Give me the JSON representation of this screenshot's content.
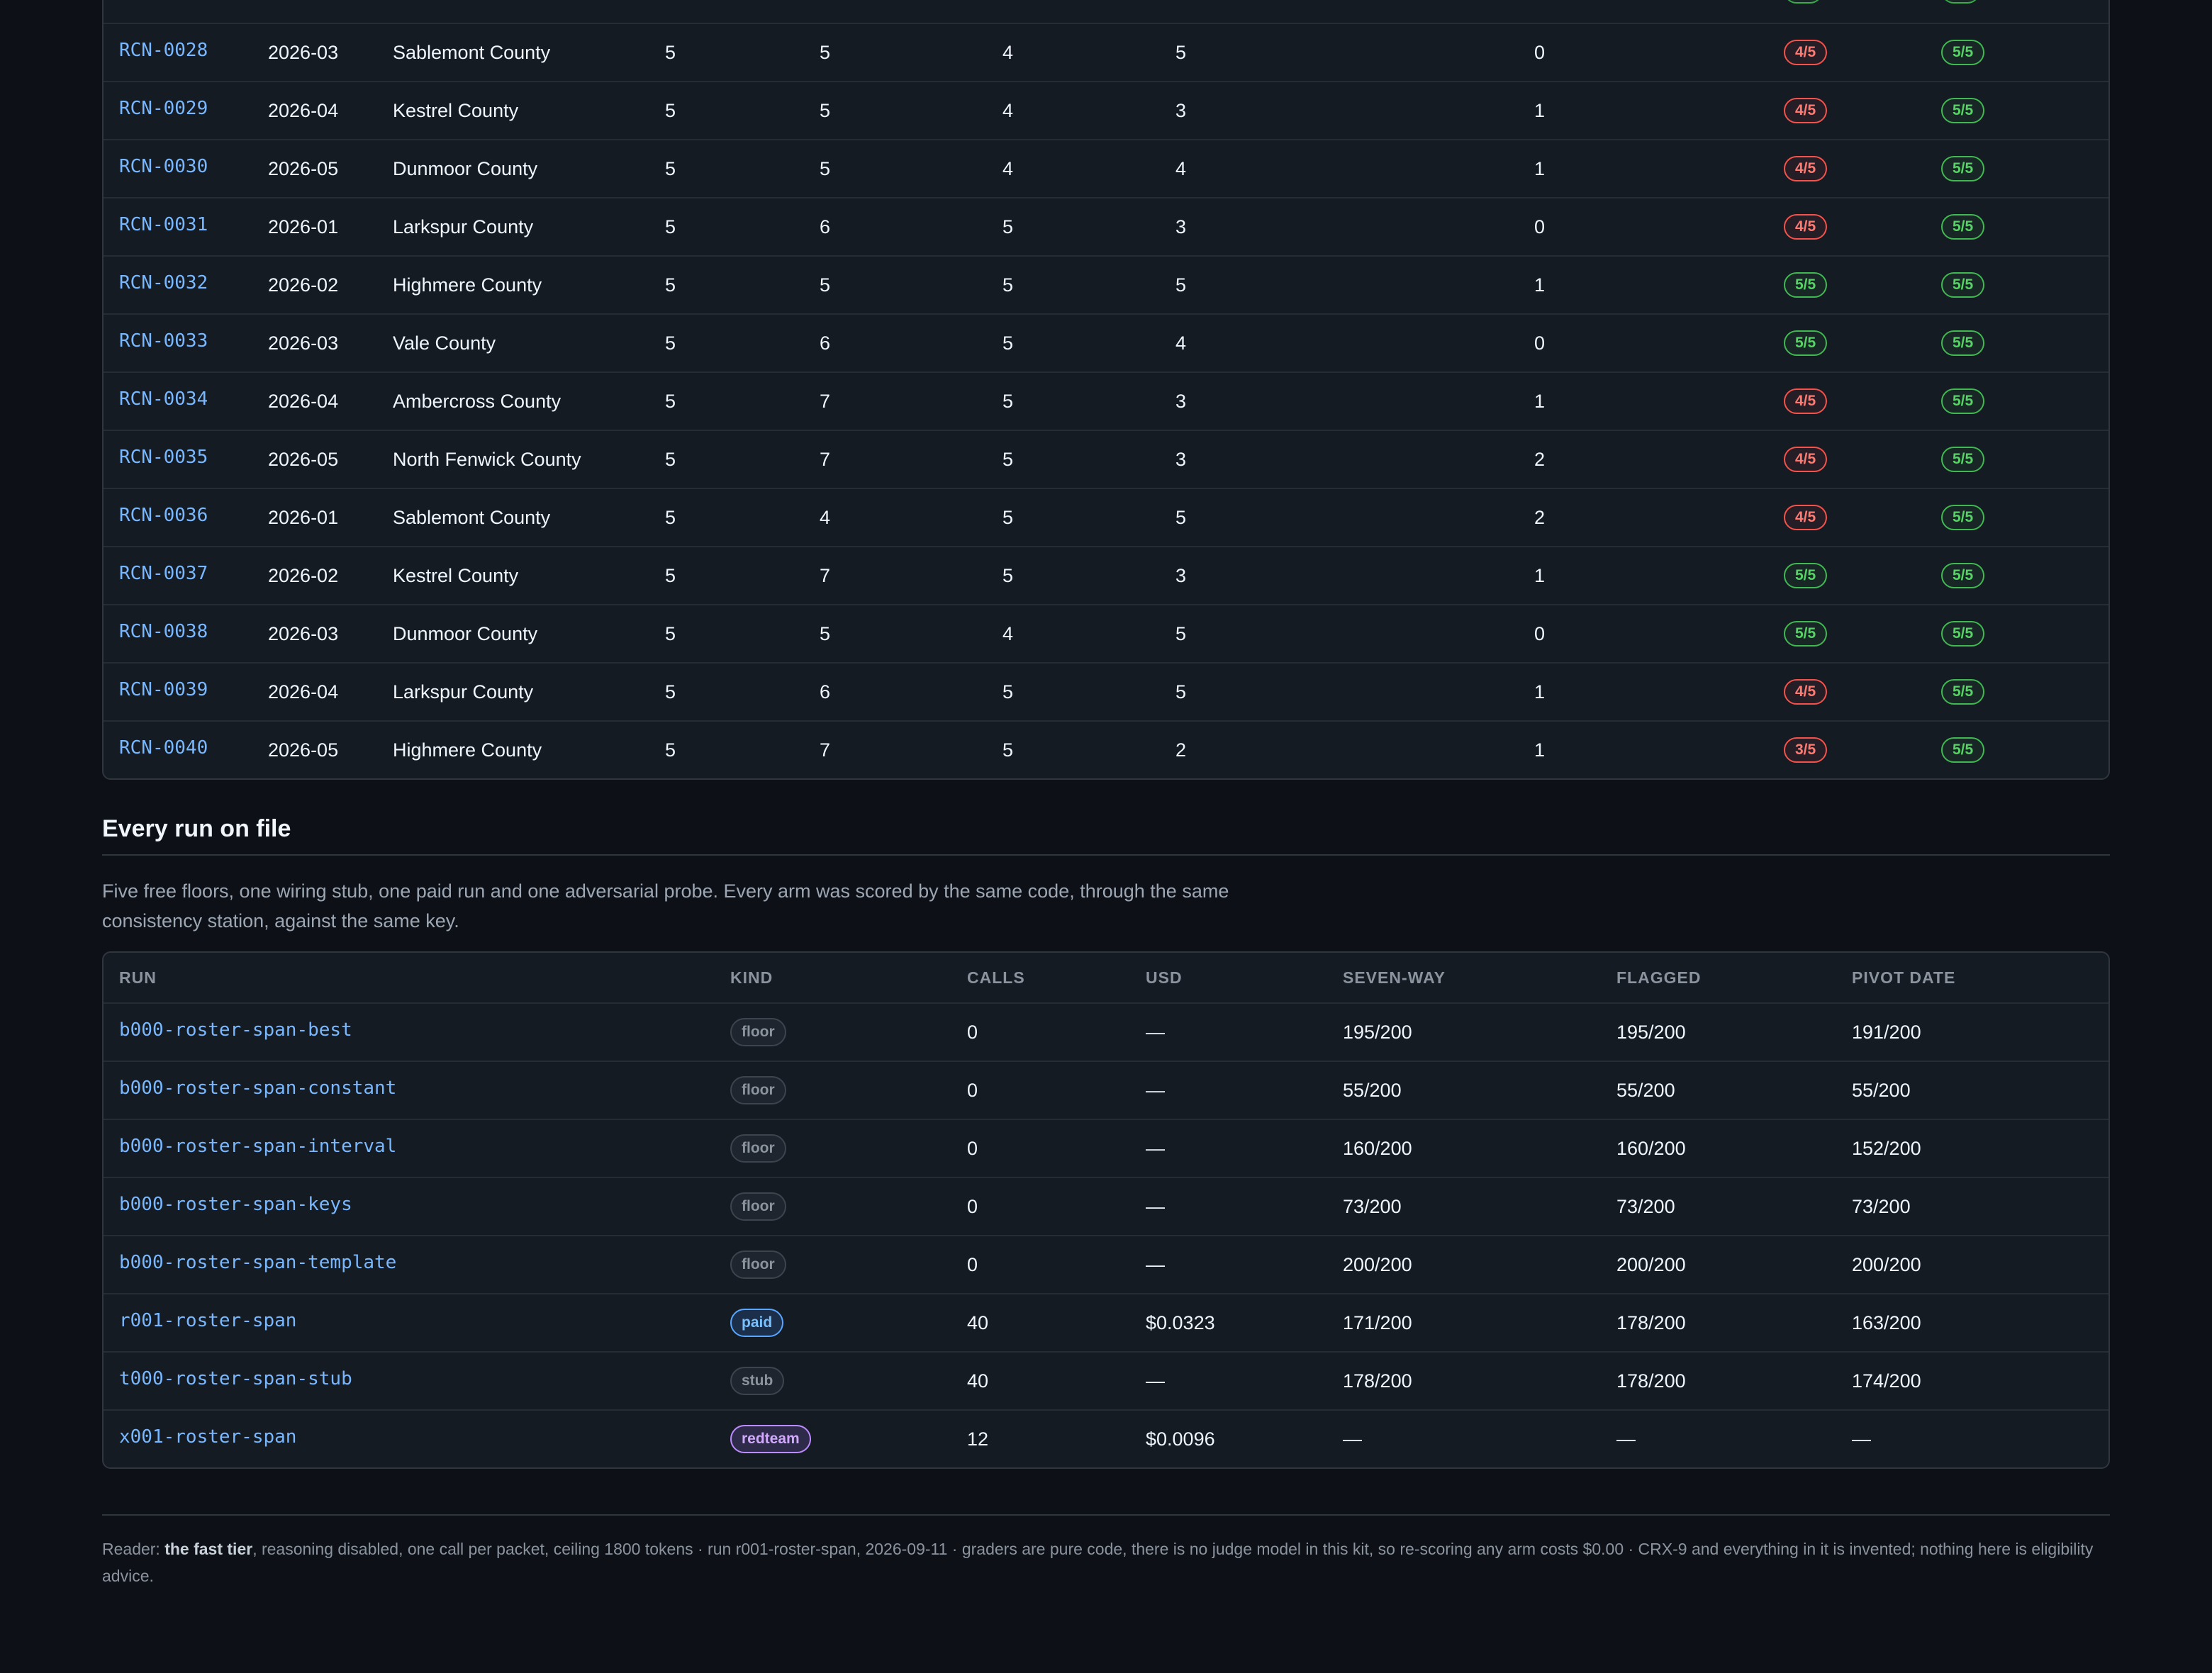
{
  "recon_table": {
    "rows": [
      {
        "id": "RCN-0028",
        "month": "2026-03",
        "county": "Sablemont County",
        "c1": "5",
        "c2": "5",
        "c3": "4",
        "c4": "5",
        "c5": "0",
        "s1": "4/5",
        "s1_status": "bad",
        "s2": "5/5",
        "s2_status": "good"
      },
      {
        "id": "RCN-0029",
        "month": "2026-04",
        "county": "Kestrel County",
        "c1": "5",
        "c2": "5",
        "c3": "4",
        "c4": "3",
        "c5": "1",
        "s1": "4/5",
        "s1_status": "bad",
        "s2": "5/5",
        "s2_status": "good"
      },
      {
        "id": "RCN-0030",
        "month": "2026-05",
        "county": "Dunmoor County",
        "c1": "5",
        "c2": "5",
        "c3": "4",
        "c4": "4",
        "c5": "1",
        "s1": "4/5",
        "s1_status": "bad",
        "s2": "5/5",
        "s2_status": "good"
      },
      {
        "id": "RCN-0031",
        "month": "2026-01",
        "county": "Larkspur County",
        "c1": "5",
        "c2": "6",
        "c3": "5",
        "c4": "3",
        "c5": "0",
        "s1": "4/5",
        "s1_status": "bad",
        "s2": "5/5",
        "s2_status": "good"
      },
      {
        "id": "RCN-0032",
        "month": "2026-02",
        "county": "Highmere County",
        "c1": "5",
        "c2": "5",
        "c3": "5",
        "c4": "5",
        "c5": "1",
        "s1": "5/5",
        "s1_status": "good",
        "s2": "5/5",
        "s2_status": "good"
      },
      {
        "id": "RCN-0033",
        "month": "2026-03",
        "county": "Vale County",
        "c1": "5",
        "c2": "6",
        "c3": "5",
        "c4": "4",
        "c5": "0",
        "s1": "5/5",
        "s1_status": "good",
        "s2": "5/5",
        "s2_status": "good"
      },
      {
        "id": "RCN-0034",
        "month": "2026-04",
        "county": "Ambercross County",
        "c1": "5",
        "c2": "7",
        "c3": "5",
        "c4": "3",
        "c5": "1",
        "s1": "4/5",
        "s1_status": "bad",
        "s2": "5/5",
        "s2_status": "good"
      },
      {
        "id": "RCN-0035",
        "month": "2026-05",
        "county": "North Fenwick County",
        "c1": "5",
        "c2": "7",
        "c3": "5",
        "c4": "3",
        "c5": "2",
        "s1": "4/5",
        "s1_status": "bad",
        "s2": "5/5",
        "s2_status": "good"
      },
      {
        "id": "RCN-0036",
        "month": "2026-01",
        "county": "Sablemont County",
        "c1": "5",
        "c2": "4",
        "c3": "5",
        "c4": "5",
        "c5": "2",
        "s1": "4/5",
        "s1_status": "bad",
        "s2": "5/5",
        "s2_status": "good"
      },
      {
        "id": "RCN-0037",
        "month": "2026-02",
        "county": "Kestrel County",
        "c1": "5",
        "c2": "7",
        "c3": "5",
        "c4": "3",
        "c5": "1",
        "s1": "5/5",
        "s1_status": "good",
        "s2": "5/5",
        "s2_status": "good"
      },
      {
        "id": "RCN-0038",
        "month": "2026-03",
        "county": "Dunmoor County",
        "c1": "5",
        "c2": "5",
        "c3": "4",
        "c4": "5",
        "c5": "0",
        "s1": "5/5",
        "s1_status": "good",
        "s2": "5/5",
        "s2_status": "good"
      },
      {
        "id": "RCN-0039",
        "month": "2026-04",
        "county": "Larkspur County",
        "c1": "5",
        "c2": "6",
        "c3": "5",
        "c4": "5",
        "c5": "1",
        "s1": "4/5",
        "s1_status": "bad",
        "s2": "5/5",
        "s2_status": "good"
      },
      {
        "id": "RCN-0040",
        "month": "2026-05",
        "county": "Highmere County",
        "c1": "5",
        "c2": "7",
        "c3": "5",
        "c4": "2",
        "c5": "1",
        "s1": "3/5",
        "s1_status": "bad",
        "s2": "5/5",
        "s2_status": "good"
      }
    ]
  },
  "runs_section": {
    "title": "Every run on file",
    "description": "Five free floors, one wiring stub, one paid run and one adversarial probe. Every arm was scored by the same code, through the same consistency station, against the same key.",
    "columns": [
      "RUN",
      "KIND",
      "CALLS",
      "USD",
      "SEVEN-WAY",
      "FLAGGED",
      "PIVOT DATE"
    ],
    "rows": [
      {
        "run": "b000-roster-span-best",
        "kind": "floor",
        "calls": "0",
        "usd": "—",
        "seven_way": "195/200",
        "flagged": "195/200",
        "pivot_date": "191/200"
      },
      {
        "run": "b000-roster-span-constant",
        "kind": "floor",
        "calls": "0",
        "usd": "—",
        "seven_way": "55/200",
        "flagged": "55/200",
        "pivot_date": "55/200"
      },
      {
        "run": "b000-roster-span-interval",
        "kind": "floor",
        "calls": "0",
        "usd": "—",
        "seven_way": "160/200",
        "flagged": "160/200",
        "pivot_date": "152/200"
      },
      {
        "run": "b000-roster-span-keys",
        "kind": "floor",
        "calls": "0",
        "usd": "—",
        "seven_way": "73/200",
        "flagged": "73/200",
        "pivot_date": "73/200"
      },
      {
        "run": "b000-roster-span-template",
        "kind": "floor",
        "calls": "0",
        "usd": "—",
        "seven_way": "200/200",
        "flagged": "200/200",
        "pivot_date": "200/200"
      },
      {
        "run": "r001-roster-span",
        "kind": "paid",
        "calls": "40",
        "usd": "$0.0323",
        "seven_way": "171/200",
        "flagged": "178/200",
        "pivot_date": "163/200"
      },
      {
        "run": "t000-roster-span-stub",
        "kind": "stub",
        "calls": "40",
        "usd": "—",
        "seven_way": "178/200",
        "flagged": "178/200",
        "pivot_date": "174/200"
      },
      {
        "run": "x001-roster-span",
        "kind": "redteam",
        "calls": "12",
        "usd": "$0.0096",
        "seven_way": "—",
        "flagged": "—",
        "pivot_date": "—"
      }
    ]
  },
  "footer": {
    "prefix": "Reader: ",
    "tier": "the fast tier",
    "rest": ", reasoning disabled, one call per packet, ceiling 1800 tokens · run r001-roster-span, 2026-09-11 · graders are pure code, there is no judge model in this kit, so re-scoring any arm costs $0.00 · CRX-9 and everything in it is invented; nothing here is eligibility advice."
  },
  "colors": {
    "background": "#0d1117",
    "link": "#79b8ff",
    "bad": "#f85149",
    "good": "#3fb950",
    "paid": "#58a6ff",
    "redteam": "#bc8cff"
  }
}
